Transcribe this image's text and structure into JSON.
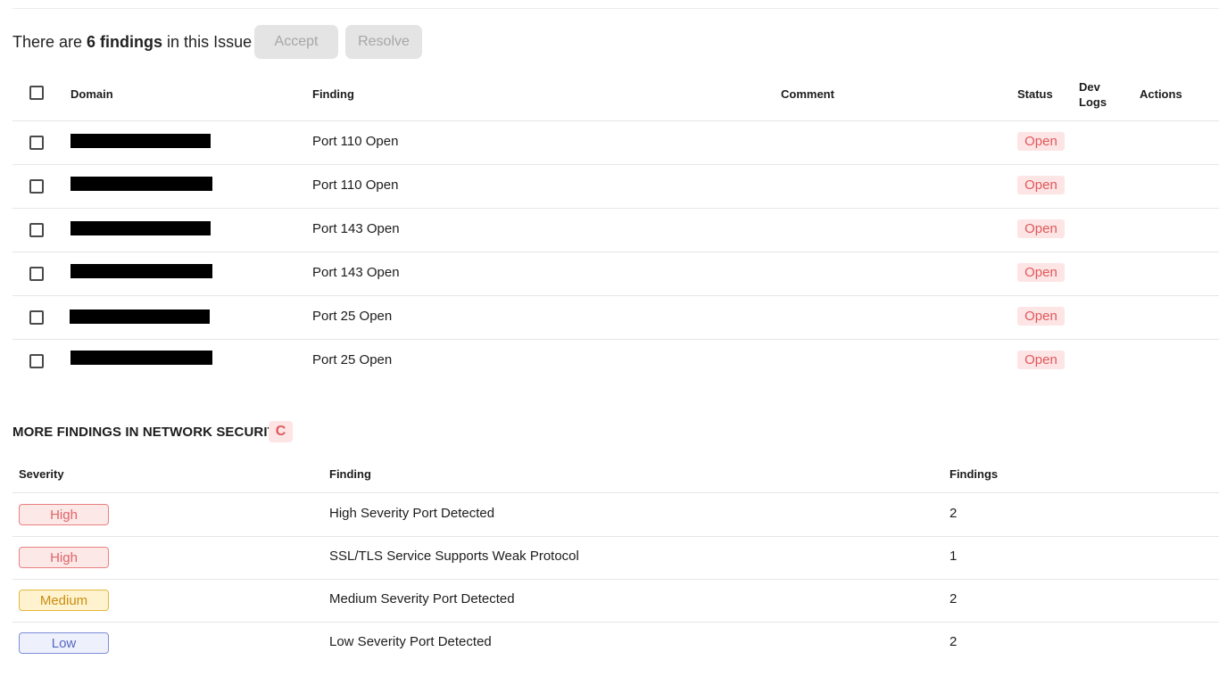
{
  "issue": {
    "summary_prefix": "There are ",
    "summary_count": "6 findings",
    "summary_suffix": " in this Issue",
    "accept_label": "Accept",
    "resolve_label": "Resolve"
  },
  "table": {
    "headers": {
      "domain": "Domain",
      "finding": "Finding",
      "comment": "Comment",
      "status": "Status",
      "dev_logs_line1": "Dev",
      "dev_logs_line2": "Logs",
      "actions": "Actions"
    },
    "rows": [
      {
        "finding": "Port 110 Open",
        "status": "Open"
      },
      {
        "finding": "Port 110 Open",
        "status": "Open"
      },
      {
        "finding": "Port 143 Open",
        "status": "Open"
      },
      {
        "finding": "Port 143 Open",
        "status": "Open"
      },
      {
        "finding": "Port 25 Open",
        "status": "Open"
      },
      {
        "finding": "Port 25 Open",
        "status": "Open"
      }
    ]
  },
  "more_findings": {
    "title": "MORE FINDINGS IN NETWORK SECURITY",
    "grade": "C",
    "headers": {
      "severity": "Severity",
      "finding": "Finding",
      "findings": "Findings"
    },
    "rows": [
      {
        "severity": "High",
        "finding": "High Severity Port Detected",
        "count": "2"
      },
      {
        "severity": "High",
        "finding": "SSL/TLS Service Supports Weak Protocol",
        "count": "1"
      },
      {
        "severity": "Medium",
        "finding": "Medium Severity Port Detected",
        "count": "2"
      },
      {
        "severity": "Low",
        "finding": "Low Severity Port Detected",
        "count": "2"
      }
    ]
  },
  "colors": {
    "open_badge_bg": "#fde5e5",
    "open_badge_text": "#e0575b",
    "high": "#e06468",
    "medium": "#c98d10",
    "low": "#5567c2",
    "disabled_button": "#e4e4e4"
  }
}
